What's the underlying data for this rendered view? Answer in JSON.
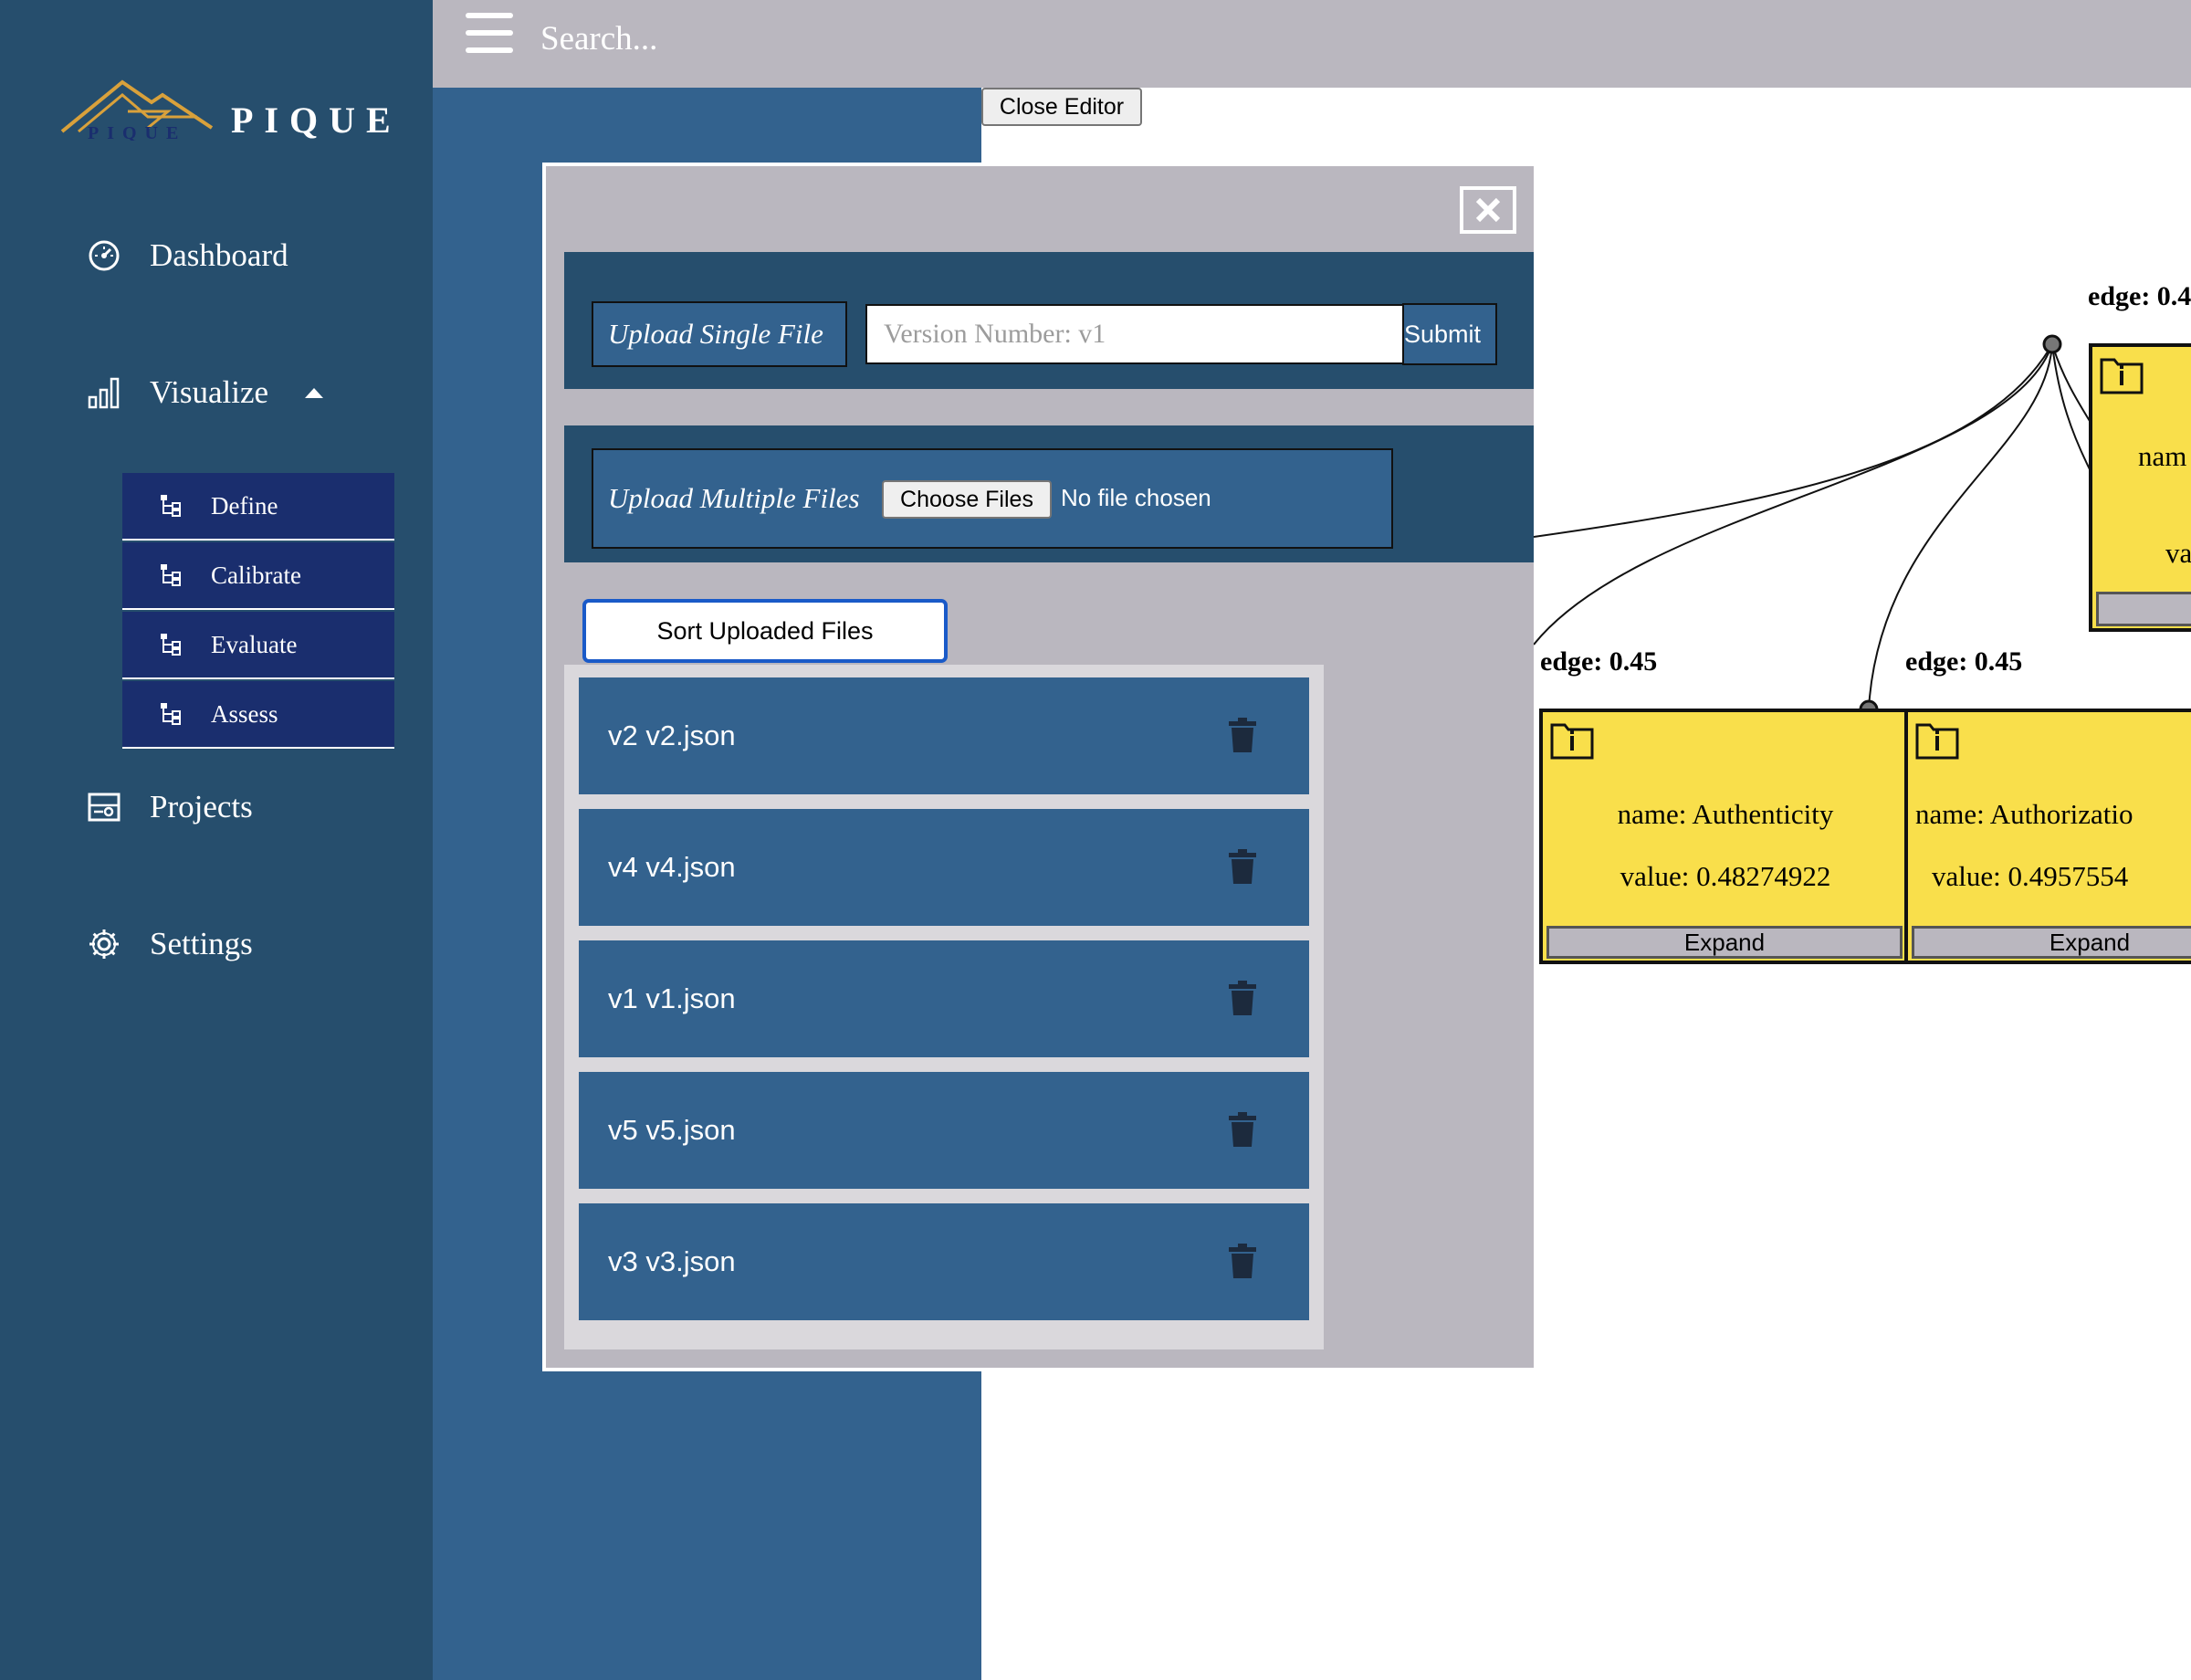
{
  "brand": {
    "name": "PIQUE",
    "logo_text": "PIQUE"
  },
  "sidebar": {
    "items": [
      {
        "label": "Dashboard",
        "icon": "gauge-icon"
      },
      {
        "label": "Visualize",
        "icon": "bar-chart-icon",
        "expanded": true
      },
      {
        "label": "Projects",
        "icon": "project-icon"
      },
      {
        "label": "Settings",
        "icon": "gear-icon"
      }
    ],
    "sub_items": [
      {
        "label": "Define",
        "icon": "tree-icon"
      },
      {
        "label": "Calibrate",
        "icon": "tree-icon"
      },
      {
        "label": "Evaluate",
        "icon": "tree-icon"
      },
      {
        "label": "Assess",
        "icon": "tree-icon"
      }
    ]
  },
  "header": {
    "search_placeholder": "Search..."
  },
  "close_editor_label": "Close Editor",
  "modal": {
    "upload_single_label": "Upload Single File",
    "version_placeholder": "Version Number: v1",
    "submit_label": "Submit",
    "upload_multiple_label": "Upload Multiple Files",
    "choose_files_label": "Choose Files",
    "no_file_text": "No file chosen",
    "sort_label": "Sort Uploaded Files",
    "files": [
      "v2 v2.json",
      "v4 v4.json",
      "v1 v1.json",
      "v5 v5.json",
      "v3 v3.json"
    ]
  },
  "graph": {
    "edge_labels": [
      "edge: 0.4",
      "edge: 0.45",
      "edge: 0.45"
    ],
    "nodes": [
      {
        "name_text": "name: Authenticity",
        "value_text": "value: 0.48274922",
        "expand_label": "Expand"
      },
      {
        "name_text": "name: Authorizatio",
        "value_text": "value: 0.4957554",
        "expand_label": "Expand"
      },
      {
        "name_text": "nam",
        "value_text": "va",
        "expand_label": ""
      }
    ]
  },
  "colors": {
    "sidebar_bg": "#264e6d",
    "submenu_bg": "#1a2e6e",
    "panel_blue": "#33628e",
    "gray": "#bab7bf",
    "node_yellow": "#f9df4b",
    "logo_gold": "#d9a13b"
  }
}
